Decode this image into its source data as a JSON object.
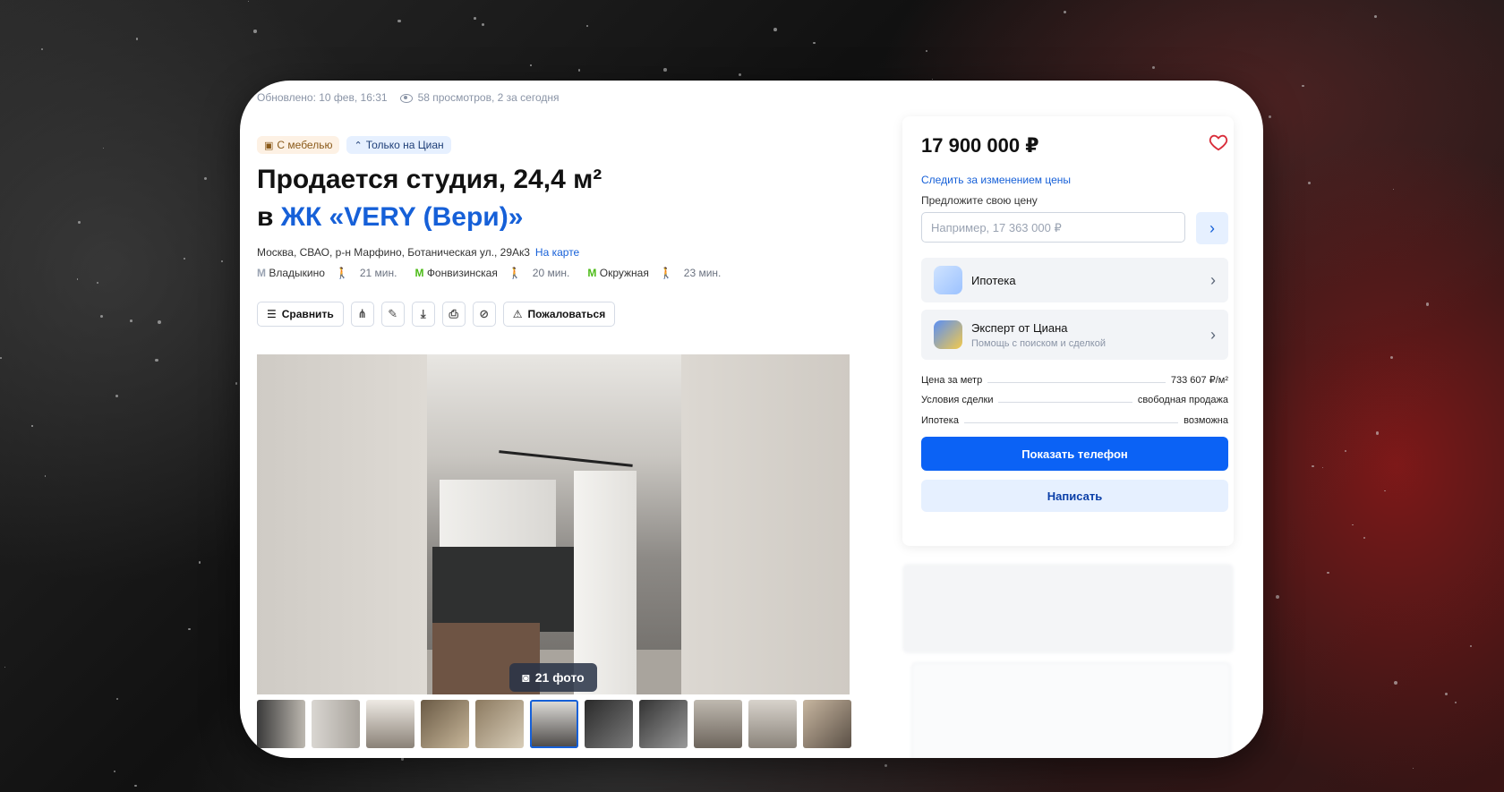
{
  "meta": {
    "updated": "Обновлено: 10 фев, 16:31",
    "views": "58 просмотров, 2 за сегодня"
  },
  "badges": {
    "furniture": "С мебелью",
    "only_cian": "Только на Циан"
  },
  "title": {
    "line1": "Продается студия, 24,4 м²",
    "prefix": "в ",
    "complex": "ЖК «VERY (Вери)»"
  },
  "address": {
    "text": "Москва, СВАО, р-н Марфино, Ботаническая ул., 29Ак3",
    "map_link": "На карте"
  },
  "metro": [
    {
      "station": "Владыкино",
      "time": "21 мин.",
      "color": "#9aa3b2"
    },
    {
      "station": "Фонвизинская",
      "time": "20 мин.",
      "color": "#4cbb17"
    },
    {
      "station": "Окружная",
      "time": "23 мин.",
      "color": "#4cbb17"
    }
  ],
  "actions": {
    "compare": "Сравнить",
    "complain": "Пожаловаться"
  },
  "gallery": {
    "photo_count": "21 фото",
    "selected_index": 5
  },
  "sidebar": {
    "price": "17 900 000 ₽",
    "track_price": "Следить за изменением цены",
    "offer_label": "Предложите свою цену",
    "offer_placeholder": "Например, 17 363 000 ₽",
    "mortgage": "Ипотека",
    "expert_title": "Эксперт от Циана",
    "expert_sub": "Помощь с поиском и сделкой",
    "info": [
      {
        "label": "Цена за метр",
        "value": "733 607 ₽/м²"
      },
      {
        "label": "Условия сделки",
        "value": "свободная продажа"
      },
      {
        "label": "Ипотека",
        "value": "возможна"
      }
    ],
    "show_phone": "Показать телефон",
    "write": "Написать"
  },
  "colors": {
    "accent": "#0b62f5",
    "link": "#1660d8"
  }
}
